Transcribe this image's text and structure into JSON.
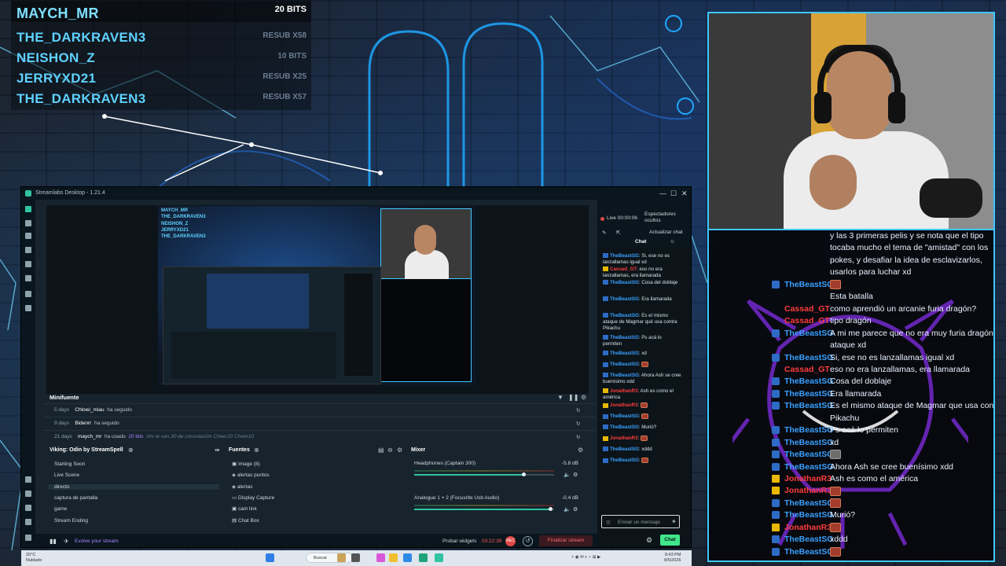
{
  "events": [
    {
      "name": "MAYCH_MR",
      "value": "20 BITS"
    },
    {
      "name": "THE_DARKRAVEN3",
      "value": "RESUB X58"
    },
    {
      "name": "NEISHON_Z",
      "value": "10 BITS"
    },
    {
      "name": "JERRYXD21",
      "value": "RESUB X25"
    },
    {
      "name": "THE_DARKRAVEN3",
      "value": "RESUB X57"
    }
  ],
  "overlay_chat": [
    {
      "nick": "",
      "text": "y las 3 primeras pelis y se nota que el tipo",
      "badge": "none",
      "color": "#ffffff"
    },
    {
      "nick": "",
      "text": "tocaba mucho el tema de \"amistad\" con los",
      "badge": "none",
      "color": "#ffffff"
    },
    {
      "nick": "",
      "text": "pokes, y desafiar la idea de esclavizarlos,",
      "badge": "none",
      "color": "#ffffff"
    },
    {
      "nick": "",
      "text": "usarlos para luchar xd",
      "badge": "none",
      "color": "#ffffff"
    },
    {
      "nick": "TheBeastSG",
      "text": "",
      "badge": "blue",
      "color": "#3aa0ff",
      "emote": "red"
    },
    {
      "nick": "",
      "text": "Esta batalla",
      "badge": "none",
      "color": "#ffffff",
      "indent": "nick"
    },
    {
      "nick": "Cassad_GT",
      "text": "como aprendió un arcanie furia dragón?",
      "badge": "none",
      "color": "#ff3c3c"
    },
    {
      "nick": "Cassad_GT",
      "text": "tipo dragón",
      "badge": "none",
      "color": "#ff3c3c"
    },
    {
      "nick": "TheBeastSG",
      "text": "A mi me parece que no era muy furia dragón ese",
      "badge": "blue",
      "color": "#3aa0ff"
    },
    {
      "nick": "",
      "text": "ataque xd",
      "badge": "none",
      "color": "#ffffff"
    },
    {
      "nick": "TheBeastSG",
      "text": "Si, ese no es lanzallamas igual xd",
      "badge": "blue",
      "color": "#3aa0ff"
    },
    {
      "nick": "Cassad_GT",
      "text": "eso no era lanzallamas, era llamarada",
      "badge": "none",
      "color": "#ff3c3c"
    },
    {
      "nick": "TheBeastSG",
      "text": "Cosa del doblaje",
      "badge": "blue",
      "color": "#3aa0ff"
    },
    {
      "nick": "TheBeastSG",
      "text": "Era llamarada",
      "badge": "blue",
      "color": "#3aa0ff"
    },
    {
      "nick": "TheBeastSG",
      "text": "Es el mismo ataque de Magmar que usa contra",
      "badge": "blue",
      "color": "#3aa0ff"
    },
    {
      "nick": "",
      "text": "Pikachu",
      "badge": "none",
      "color": "#ffffff"
    },
    {
      "nick": "TheBeastSG",
      "text": "Ps acá lo permiten",
      "badge": "blue",
      "color": "#3aa0ff"
    },
    {
      "nick": "TheBeastSG",
      "text": "xd",
      "badge": "blue",
      "color": "#3aa0ff"
    },
    {
      "nick": "TheBeastSG",
      "text": "",
      "badge": "blue",
      "color": "#3aa0ff",
      "emote": "gray"
    },
    {
      "nick": "TheBeastSG",
      "text": "Ahora Ash se cree buenísimo xdd",
      "badge": "blue",
      "color": "#3aa0ff"
    },
    {
      "nick": "JonathanR3",
      "text": "Ash es como el américa",
      "badge": "crown",
      "color": "#ff3c3c"
    },
    {
      "nick": "JonathanR3",
      "text": "",
      "badge": "crown",
      "color": "#ff3c3c",
      "emote": "red"
    },
    {
      "nick": "TheBeastSG",
      "text": "",
      "badge": "blue",
      "color": "#3aa0ff",
      "emote": "red"
    },
    {
      "nick": "TheBeastSG",
      "text": "Murió?",
      "badge": "blue",
      "color": "#3aa0ff"
    },
    {
      "nick": "JonathanR3",
      "text": "",
      "badge": "crown",
      "color": "#ff3c3c",
      "emote": "red"
    },
    {
      "nick": "TheBeastSG",
      "text": "xddd",
      "badge": "blue",
      "color": "#3aa0ff"
    },
    {
      "nick": "TheBeastSG",
      "text": "",
      "badge": "blue",
      "color": "#3aa0ff",
      "emote": "red"
    }
  ],
  "streamlabs": {
    "title": "Streamlabs Desktop - 1.21.4",
    "live_label": "Live 00:00:06",
    "viewers_label": "Espectadores ocultos",
    "refresh_chat": "Actualizar chat",
    "chat_tab": "Chat",
    "chat_messages": [
      {
        "nick": "TheBeastSG",
        "text": "Si, ese no es lanzallamas igual xd",
        "red": false
      },
      {
        "nick": "Cassad_GT",
        "text": "eso no era lanzallamas, era llamarada",
        "red": true
      },
      {
        "nick": "TheBeastSG",
        "text": "Cosa del doblaje",
        "red": false
      },
      {
        "nick": "TheBeastSG",
        "text": "Era llamarada",
        "red": false
      },
      {
        "nick": "TheBeastSG",
        "text": "Es el mismo ataque de Magmar qué usa contra Pikachu",
        "red": false
      },
      {
        "nick": "TheBeastSG",
        "text": "Ps acá lo permiten",
        "red": false
      },
      {
        "nick": "TheBeastSG",
        "text": "xd",
        "red": false
      },
      {
        "nick": "TheBeastSG",
        "text": "",
        "red": false
      },
      {
        "nick": "TheBeastSG",
        "text": "Ahora Ash se cree buenísimo xdd",
        "red": false
      },
      {
        "nick": "JonathanR3",
        "text": "Ash es como el américa",
        "red": true
      },
      {
        "nick": "JonathanR3",
        "text": "",
        "red": true
      },
      {
        "nick": "TheBeastSG",
        "text": "",
        "red": false
      },
      {
        "nick": "TheBeastSG",
        "text": "Murió?",
        "red": false
      },
      {
        "nick": "JonathanR3",
        "text": "",
        "red": true
      },
      {
        "nick": "TheBeastSG",
        "text": "xddd",
        "red": false
      },
      {
        "nick": "TheBeastSG",
        "text": "",
        "red": false
      }
    ],
    "chat_input_placeholder": "Enviar un mensaje",
    "chat_button": "Chat",
    "minifeed": {
      "title": "Minifuente",
      "rows": [
        {
          "days": "5 days",
          "user": "Chlowi_miau",
          "action": "ha seguido",
          "bits": "",
          "msg": ""
        },
        {
          "days": "9 days",
          "user": "Bidenrr",
          "action": "ha seguido",
          "bits": "",
          "msg": ""
        },
        {
          "days": "21 days",
          "user": "maych_mr",
          "action": "ha usado",
          "bits": "20 bits",
          "msg": "Ahí te van 20 de consolación Cheer10 Cheer10"
        }
      ]
    },
    "scenes": {
      "title": "Viking: Odin by StreamSpell",
      "items": [
        "Starting Soon",
        "Live Scene",
        "directo",
        "captura de pantalla",
        "game",
        "Stream Ending"
      ],
      "selected_index": 2
    },
    "sources": {
      "title": "Fuentes",
      "items": [
        "Image (8)",
        "alertas puntos",
        "alertas",
        "Display Capture",
        "cam link",
        "Chat Box"
      ]
    },
    "mixer": {
      "title": "Mixer",
      "channels": [
        {
          "name": "Headphones (Captain 300)",
          "db": "-5.8 dB",
          "level": 0.78
        },
        {
          "name": "Analogue 1 + 2 (Focusrite Usb Audio)",
          "db": "-0.4 dB",
          "level": 0.97
        }
      ]
    },
    "footer": {
      "evolve": "Evolve your stream",
      "test_widgets": "Probar widgets",
      "time": "03:22:39",
      "rec": "REC",
      "end_stream": "Finalizar stream"
    }
  },
  "taskbar": {
    "weather_temp": "20°C",
    "weather_desc": "Nublado",
    "search": "Buscar",
    "time": "8:43 PM",
    "date": "8/5/2026"
  }
}
